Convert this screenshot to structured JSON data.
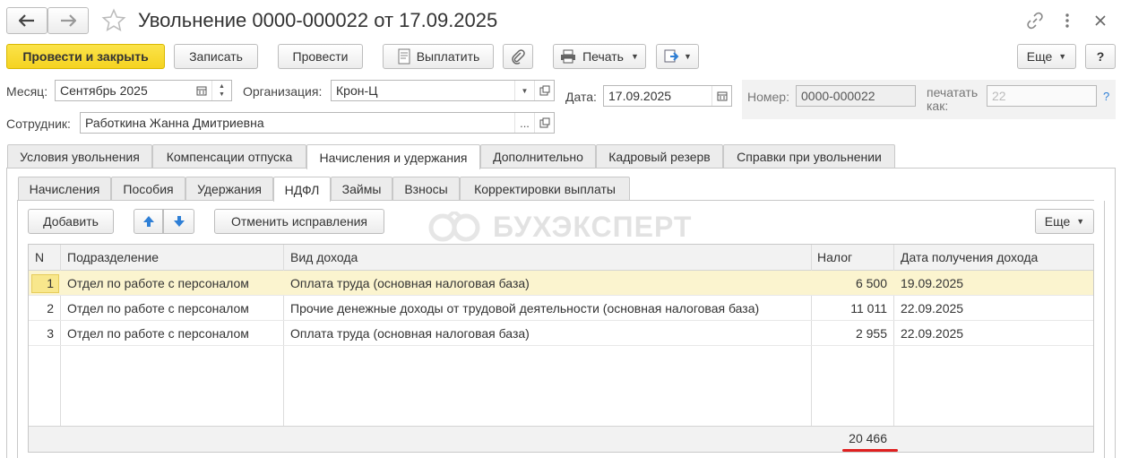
{
  "header": {
    "back_icon": "arrow-left-icon",
    "forward_icon": "arrow-right-icon",
    "favorite_icon": "star-icon",
    "title": "Увольнение 0000-000022 от 17.09.2025",
    "link_icon": "link-icon",
    "more_icon": "vertical-dots-icon",
    "close_icon": "close-icon"
  },
  "toolbar": {
    "post_close": "Провести и закрыть",
    "save": "Записать",
    "post": "Провести",
    "pay": "Выплатить",
    "attach_icon": "paperclip-icon",
    "print": "Печать",
    "more": "Еще",
    "help": "?"
  },
  "form": {
    "month_label": "Месяц:",
    "month_value": "Сентябрь 2025",
    "org_label": "Организация:",
    "org_value": "Крон-Ц",
    "date_label": "Дата:",
    "date_value": "17.09.2025",
    "number_label": "Номер:",
    "number_value": "0000-000022",
    "print_as_label": "печатать как:",
    "print_as_placeholder": "22",
    "help_mark": "?",
    "employee_label": "Сотрудник:",
    "employee_value": "Работкина Жанна Дмитриевна",
    "ellipsis": "..."
  },
  "main_tabs": [
    "Условия увольнения",
    "Компенсации отпуска",
    "Начисления и удержания",
    "Дополнительно",
    "Кадровый резерв",
    "Справки при увольнении"
  ],
  "sub_tabs": [
    "Начисления",
    "Пособия",
    "Удержания",
    "НДФЛ",
    "Займы",
    "Взносы",
    "Корректировки выплаты"
  ],
  "table_toolbar": {
    "add": "Добавить",
    "cancel_corrections": "Отменить исправления",
    "more": "Еще",
    "watermark": "БУХЭКСПЕРТ"
  },
  "table": {
    "headers": [
      "N",
      "Подразделение",
      "Вид дохода",
      "Налог",
      "Дата получения дохода"
    ],
    "rows": [
      {
        "n": "1",
        "dept": "Отдел по работе с персоналом",
        "income": "Оплата труда (основная налоговая база)",
        "tax": "6 500",
        "date": "19.09.2025"
      },
      {
        "n": "2",
        "dept": "Отдел по работе с персоналом",
        "income": "Прочие денежные доходы от трудовой деятельности (основная налоговая база)",
        "tax": "11 011",
        "date": "22.09.2025"
      },
      {
        "n": "3",
        "dept": "Отдел по работе с персоналом",
        "income": "Оплата труда (основная налоговая база)",
        "tax": "2 955",
        "date": "22.09.2025"
      }
    ],
    "total_tax": "20 466"
  },
  "colors": {
    "accent_yellow": "#f5d321",
    "selected_row": "#fbf4cf",
    "underline_red": "#e02020",
    "arrow_blue": "#2e7fd6"
  }
}
